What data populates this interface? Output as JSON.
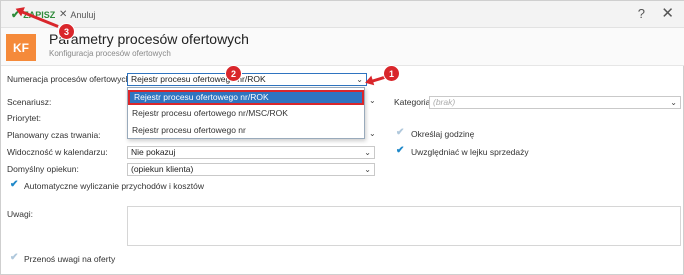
{
  "toolbar": {
    "save_label": "ZAPISZ",
    "cancel_label": "Anuluj",
    "help_label": "?",
    "close_label": "✕"
  },
  "header": {
    "logo": "KF",
    "title": "Parametry procesów ofertowych",
    "subtitle": "Konfiguracja procesów ofertowych"
  },
  "form": {
    "numeracja_label": "Numeracja procesów ofertowych:",
    "numeracja_value": "Rejestr procesu ofertowego nr/ROK",
    "scenariusz_label": "Scenariusz:",
    "priorytet_label": "Priorytet:",
    "planowany_label": "Planowany czas trwania:",
    "widocznosc_label": "Widoczność w kalendarzu:",
    "widocznosc_value": "Nie pokazuj",
    "opiekun_label": "Domyślny opiekun:",
    "opiekun_value": "(opiekun klienta)",
    "kategoria_label": "Kategoria:",
    "kategoria_placeholder": "(brak)",
    "okreslaj_label": "Określaj godzinę",
    "uwzgledniac_label": "Uwzględniać w lejku sprzedaży",
    "automatyczne_label": "Automatyczne wyliczanie przychodów i kosztów",
    "uwagi_label": "Uwagi:",
    "przenos_label": "Przenoś uwagi na oferty"
  },
  "dropdown": {
    "options": [
      "Rejestr procesu ofertowego nr/ROK",
      "Rejestr procesu ofertowego nr/MSC/ROK",
      "Rejestr procesu ofertowego nr"
    ]
  },
  "annotations": {
    "one": "1",
    "two": "2",
    "three": "3"
  },
  "colors": {
    "accent": "#2f74c0",
    "annotation": "#d9262b",
    "logo": "#f58a3a",
    "save": "#2e8b3a"
  }
}
